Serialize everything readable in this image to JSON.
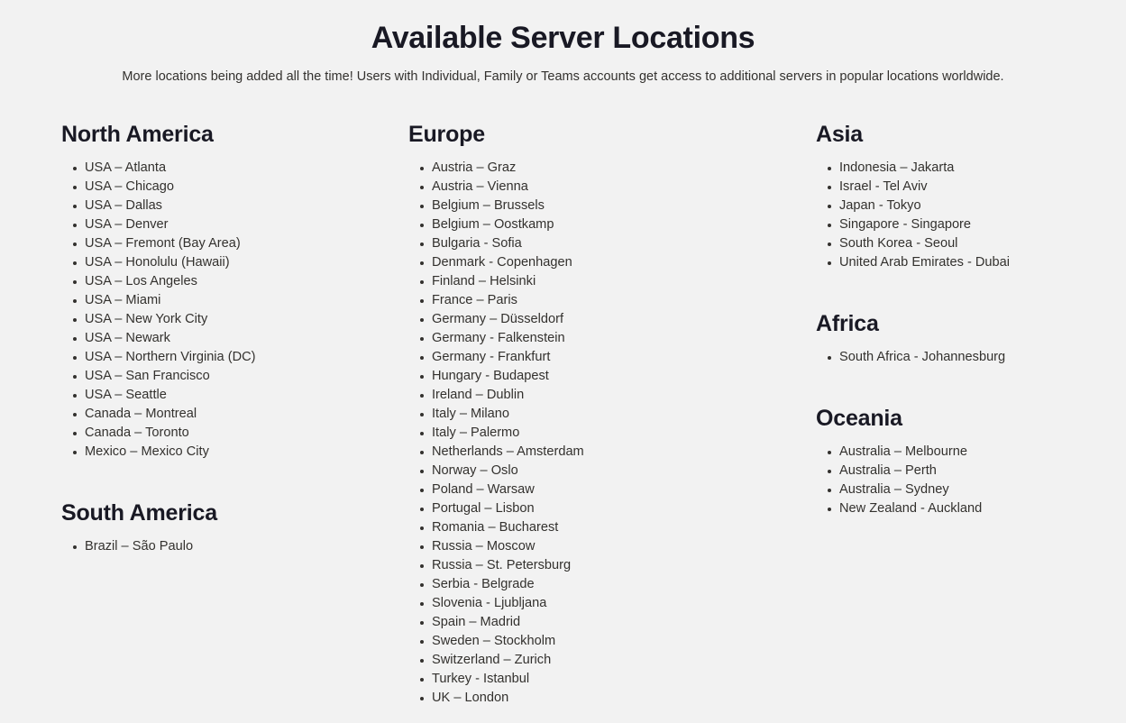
{
  "header": {
    "title": "Available Server Locations",
    "subtitle": "More locations being added all the time! Users with Individual, Family or Teams accounts get access to additional servers in popular locations worldwide."
  },
  "colors": {
    "background": "#f2f2f2",
    "heading": "#191924",
    "body_text": "#33312e",
    "bullet": "#33312e"
  },
  "columns": [
    {
      "name": "column-1",
      "sections": [
        {
          "title": "North America",
          "items": [
            "USA – Atlanta",
            "USA – Chicago",
            "USA – Dallas",
            "USA – Denver",
            "USA – Fremont (Bay Area)",
            "USA – Honolulu (Hawaii)",
            "USA – Los Angeles",
            "USA – Miami",
            "USA – New York City",
            "USA – Newark",
            "USA – Northern Virginia (DC)",
            "USA – San Francisco",
            "USA – Seattle",
            "Canada – Montreal",
            "Canada – Toronto",
            "Mexico – Mexico City"
          ]
        },
        {
          "title": "South America",
          "items": [
            "Brazil – São Paulo"
          ]
        }
      ]
    },
    {
      "name": "column-2",
      "sections": [
        {
          "title": "Europe",
          "items": [
            "Austria – Graz",
            "Austria – Vienna",
            "Belgium – Brussels",
            "Belgium – Oostkamp",
            "Bulgaria - Sofia",
            "Denmark - Copenhagen",
            "Finland – Helsinki",
            "France – Paris",
            "Germany – Düsseldorf",
            "Germany - Falkenstein",
            "Germany - Frankfurt",
            "Hungary - Budapest",
            "Ireland – Dublin",
            "Italy – Milano",
            "Italy – Palermo",
            "Netherlands – Amsterdam",
            "Norway – Oslo",
            "Poland – Warsaw",
            "Portugal – Lisbon",
            "Romania – Bucharest",
            "Russia – Moscow",
            "Russia – St. Petersburg",
            "Serbia - Belgrade",
            "Slovenia - Ljubljana",
            "Spain – Madrid",
            "Sweden – Stockholm",
            "Switzerland – Zurich",
            "Turkey - Istanbul",
            "UK – London"
          ]
        }
      ]
    },
    {
      "name": "column-3",
      "sections": [
        {
          "title": "Asia",
          "items": [
            "Indonesia – Jakarta",
            "Israel - Tel Aviv",
            "Japan - Tokyo",
            "Singapore - Singapore",
            "South Korea - Seoul",
            "United Arab Emirates - Dubai"
          ]
        },
        {
          "title": "Africa",
          "items": [
            "South Africa - Johannesburg"
          ]
        },
        {
          "title": "Oceania",
          "items": [
            "Australia – Melbourne",
            "Australia – Perth",
            "Australia – Sydney",
            "New Zealand - Auckland"
          ]
        }
      ]
    }
  ]
}
